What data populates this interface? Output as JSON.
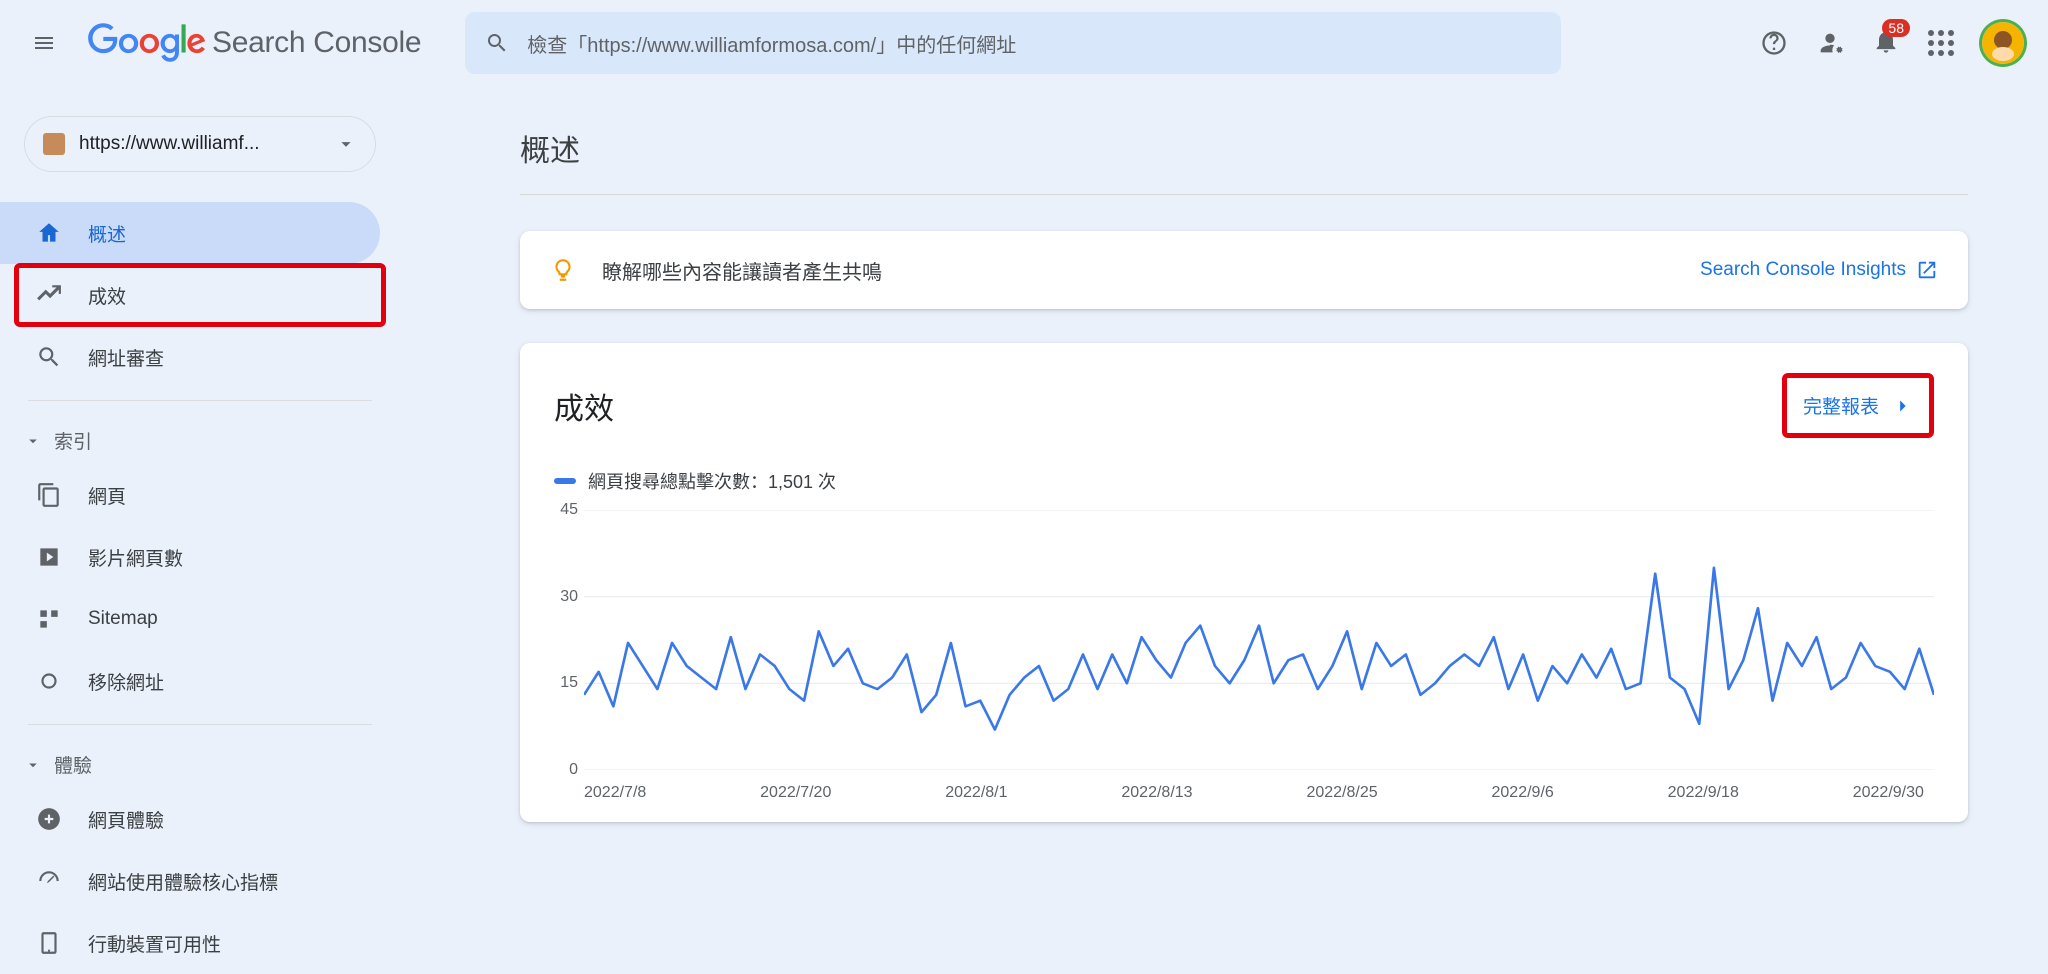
{
  "header": {
    "logo_text": "Search Console",
    "search_placeholder": "檢查「https://www.williamformosa.com/」中的任何網址",
    "notifications_count": "58"
  },
  "sidebar": {
    "property_label": "https://www.williamf...",
    "items": [
      {
        "icon": "home",
        "label": "概述",
        "active": true
      },
      {
        "icon": "trend",
        "label": "成效",
        "highlight": true
      },
      {
        "icon": "search",
        "label": "網址審查"
      }
    ],
    "section_index_label": "索引",
    "index_items": [
      {
        "icon": "pages",
        "label": "網頁"
      },
      {
        "icon": "video",
        "label": "影片網頁數"
      },
      {
        "icon": "sitemap",
        "label": "Sitemap"
      },
      {
        "icon": "remove",
        "label": "移除網址"
      }
    ],
    "section_experience_label": "體驗",
    "experience_items": [
      {
        "icon": "pageexp",
        "label": "網頁體驗"
      },
      {
        "icon": "cwv",
        "label": "網站使用體驗核心指標"
      },
      {
        "icon": "mobile",
        "label": "行動裝置可用性"
      }
    ]
  },
  "main": {
    "page_title": "概述",
    "insights": {
      "text": "瞭解哪些內容能讓讀者產生共鳴",
      "link_label": "Search Console Insights"
    },
    "performance": {
      "title": "成效",
      "full_report_label": "完整報表",
      "legend": {
        "label_prefix": "網頁搜尋總點擊次數：",
        "value": "1,501",
        "label_suffix": " 次"
      }
    }
  },
  "chart_data": {
    "type": "line",
    "title": "成效",
    "ylabel": "",
    "xlabel": "",
    "ylim": [
      0,
      45
    ],
    "y_ticks": [
      0,
      15,
      30,
      45
    ],
    "x_tick_labels": [
      "2022/7/8",
      "2022/7/20",
      "2022/8/1",
      "2022/8/13",
      "2022/8/25",
      "2022/9/6",
      "2022/9/18",
      "2022/9/30"
    ],
    "series": [
      {
        "name": "網頁搜尋總點擊次數",
        "color": "#3b78e7",
        "values": [
          13,
          17,
          11,
          22,
          18,
          14,
          22,
          18,
          16,
          14,
          23,
          14,
          20,
          18,
          14,
          12,
          24,
          18,
          21,
          15,
          14,
          16,
          20,
          10,
          13,
          22,
          11,
          12,
          7,
          13,
          16,
          18,
          12,
          14,
          20,
          14,
          20,
          15,
          23,
          19,
          16,
          22,
          25,
          18,
          15,
          19,
          25,
          15,
          19,
          20,
          14,
          18,
          24,
          14,
          22,
          18,
          20,
          13,
          15,
          18,
          20,
          18,
          23,
          14,
          20,
          12,
          18,
          15,
          20,
          16,
          21,
          14,
          15,
          34,
          16,
          14,
          8,
          35,
          14,
          19,
          28,
          12,
          22,
          18,
          23,
          14,
          16,
          22,
          18,
          17,
          14,
          21,
          13
        ]
      }
    ]
  }
}
